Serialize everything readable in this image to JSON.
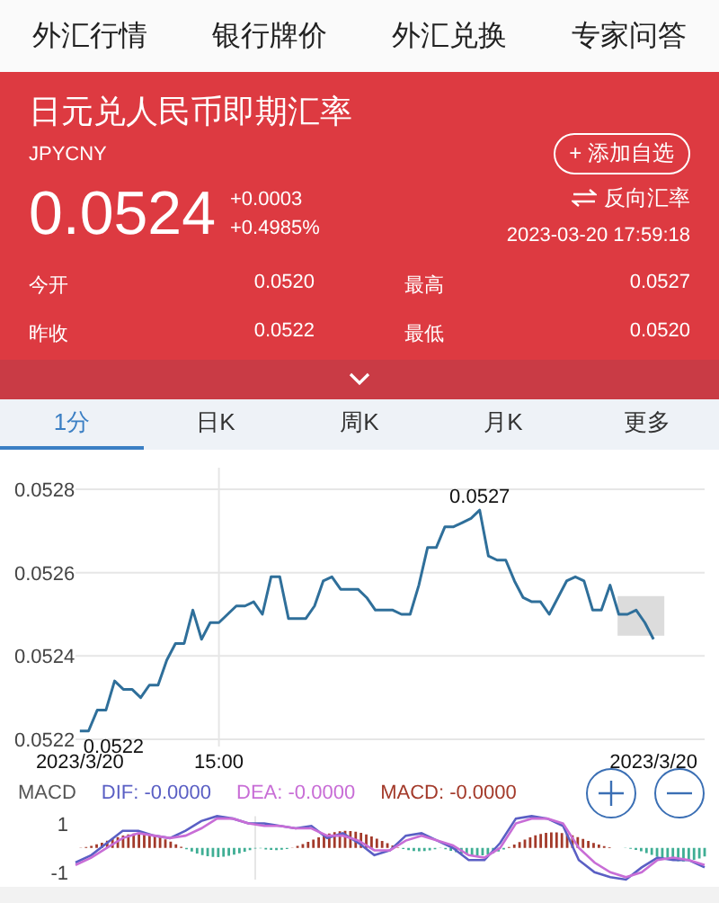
{
  "nav_tabs": [
    {
      "label": "外汇行情",
      "selected": false
    },
    {
      "label": "银行牌价",
      "selected": false
    },
    {
      "label": "外汇兑换",
      "selected": false
    },
    {
      "label": "专家问答",
      "selected": false
    }
  ],
  "quote": {
    "title": "日元兑人民币即期汇率",
    "code": "JPYCNY",
    "add_button": "+ 添加自选",
    "price": "0.0524",
    "change": "+0.0003",
    "change_pct": "+0.4985%",
    "reverse_link": "反向汇率",
    "timestamp": "2023-03-20 17:59:18",
    "stats": [
      {
        "label": "今开",
        "value": "0.0520"
      },
      {
        "label": "最高",
        "value": "0.0527"
      },
      {
        "label": "昨收",
        "value": "0.0522"
      },
      {
        "label": "最低",
        "value": "0.0520"
      }
    ]
  },
  "chart_tabs": [
    {
      "label": "1分",
      "selected": true
    },
    {
      "label": "日K",
      "selected": false
    },
    {
      "label": "周K",
      "selected": false
    },
    {
      "label": "月K",
      "selected": false
    },
    {
      "label": "更多",
      "selected": false
    }
  ],
  "price_chart": {
    "chart_data": {
      "type": "line",
      "grid": true,
      "categories": [
        "2023/3/20",
        null,
        null,
        null,
        null,
        null,
        null,
        null,
        null,
        null,
        null,
        null,
        null,
        null,
        null,
        null,
        "15:00",
        null,
        null,
        null,
        null,
        null,
        null,
        null,
        null,
        null,
        null,
        null,
        null,
        null,
        null,
        null,
        null,
        null,
        null,
        null,
        null,
        null,
        null,
        null,
        null,
        null,
        null,
        null,
        null,
        null,
        null,
        null,
        null,
        null,
        null,
        null,
        null,
        null,
        null,
        null,
        null,
        null,
        null,
        null,
        null,
        null,
        null,
        null,
        null,
        null,
        "2023/3/20"
      ],
      "ylim": [
        0.0522,
        0.0528
      ],
      "yticks": [
        {
          "value": 0.0522,
          "label": "0.0522"
        },
        {
          "value": 0.0524,
          "label": "0.0524"
        },
        {
          "value": 0.0526,
          "label": "0.0526"
        },
        {
          "value": 0.0528,
          "label": "0.0528"
        }
      ],
      "series": [
        {
          "color": "#2f6f9a",
          "values": [
            0.05222,
            0.05222,
            0.05227,
            0.05227,
            0.05234,
            0.05232,
            0.05232,
            0.0523,
            0.05233,
            0.05233,
            0.05239,
            0.05243,
            0.05243,
            0.05251,
            0.05244,
            0.05248,
            0.05248,
            0.0525,
            0.05252,
            0.05252,
            0.05253,
            0.0525,
            0.05259,
            0.05259,
            0.05249,
            0.05249,
            0.05249,
            0.05252,
            0.05258,
            0.05259,
            0.05256,
            0.05256,
            0.05256,
            0.05254,
            0.05251,
            0.05251,
            0.05251,
            0.0525,
            0.0525,
            0.05257,
            0.05266,
            0.05266,
            0.05271,
            0.05271,
            0.05272,
            0.05273,
            0.05275,
            0.05264,
            0.05263,
            0.05263,
            0.05258,
            0.05254,
            0.05253,
            0.05253,
            0.0525,
            0.05254,
            0.05258,
            0.05259,
            0.05258,
            0.05251,
            0.05251,
            0.05257,
            0.0525,
            0.0525,
            0.05251,
            0.05248,
            0.05244
          ]
        }
      ],
      "annotations": [
        "0.0522",
        "0.0527"
      ]
    }
  },
  "macd": {
    "title": "MACD",
    "legend": [
      {
        "text": "DIF: -0.0000",
        "color": "#5a5fc4"
      },
      {
        "text": "DEA: -0.0000",
        "color": "#c86dd6"
      },
      {
        "text": "MACD: -0.0000",
        "color": "#a33a2a"
      }
    ],
    "axis_labels": [
      "1",
      "-1"
    ]
  }
}
